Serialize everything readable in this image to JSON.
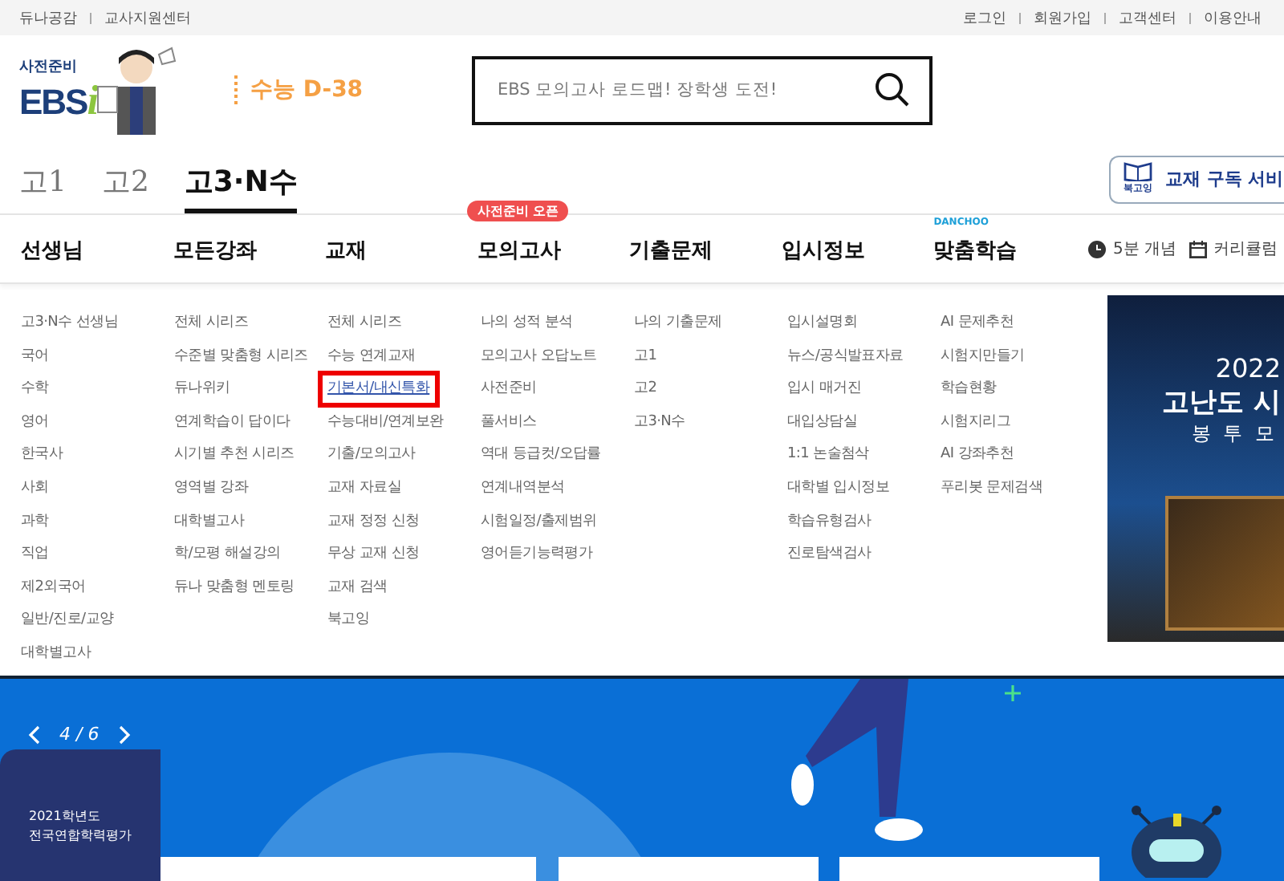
{
  "top_bar": {
    "left_links": [
      "듀나공감",
      "교사지원센터"
    ],
    "right_links": [
      "로그인",
      "회원가입",
      "고객센터",
      "이용안내"
    ]
  },
  "logo": {
    "tagline": "사전준비",
    "brand": "EBS",
    "mark": "i"
  },
  "d_day": "수능 D-38",
  "search": {
    "placeholder": "EBS 모의고사 로드맵! 장학생 도전!"
  },
  "grade_tabs": [
    {
      "label": "고1",
      "selected": false
    },
    {
      "label": "고2",
      "selected": false
    },
    {
      "label": "고3·N수",
      "selected": true
    }
  ],
  "book_service": {
    "icon_label": "북고잉",
    "label": "교재 구독 서비"
  },
  "nav": [
    {
      "label": "선생님"
    },
    {
      "label": "모든강좌"
    },
    {
      "label": "교재"
    },
    {
      "label": "모의고사",
      "badge": "사전준비 오픈"
    },
    {
      "label": "기출문제"
    },
    {
      "label": "입시정보"
    },
    {
      "label": "맞춤학습",
      "tag": "DANCHOO"
    }
  ],
  "quick_links": [
    "5분 개념",
    "커리큘럼"
  ],
  "menu_columns": [
    {
      "items": [
        {
          "label": "고3·N수 선생님",
          "highlighted": false
        },
        {
          "label": "국어",
          "highlighted": false
        },
        {
          "label": "수학",
          "highlighted": false
        },
        {
          "label": "영어",
          "highlighted": false
        },
        {
          "label": "한국사",
          "highlighted": false
        },
        {
          "label": "사회",
          "highlighted": false
        },
        {
          "label": "과학",
          "highlighted": false
        },
        {
          "label": "직업",
          "highlighted": false
        },
        {
          "label": "제2외국어",
          "highlighted": false
        },
        {
          "label": "일반/진로/교양",
          "highlighted": false
        },
        {
          "label": "대학별고사",
          "highlighted": false
        }
      ]
    },
    {
      "items": [
        {
          "label": "전체 시리즈",
          "highlighted": false
        },
        {
          "label": "수준별 맞춤형 시리즈",
          "highlighted": false
        },
        {
          "label": "듀나위키",
          "highlighted": false
        },
        {
          "label": "연계학습이 답이다",
          "highlighted": false
        },
        {
          "label": "시기별 추천 시리즈",
          "highlighted": false
        },
        {
          "label": "영역별 강좌",
          "highlighted": false
        },
        {
          "label": "대학별고사",
          "highlighted": false
        },
        {
          "label": "학/모평 해설강의",
          "highlighted": false
        },
        {
          "label": "듀나 맞춤형 멘토링",
          "highlighted": false
        }
      ]
    },
    {
      "items": [
        {
          "label": "전체 시리즈",
          "highlighted": false
        },
        {
          "label": "수능 연계교재",
          "highlighted": false
        },
        {
          "label": "기본서/내신특화",
          "highlighted": true
        },
        {
          "label": "수능대비/연계보완",
          "highlighted": false
        },
        {
          "label": "기출/모의고사",
          "highlighted": false
        },
        {
          "label": "교재 자료실",
          "highlighted": false
        },
        {
          "label": "교재 정정 신청",
          "highlighted": false
        },
        {
          "label": "무상 교재 신청",
          "highlighted": false
        },
        {
          "label": "교재 검색",
          "highlighted": false
        },
        {
          "label": "북고잉",
          "highlighted": false
        }
      ]
    },
    {
      "items": [
        {
          "label": "나의 성적 분석",
          "highlighted": false
        },
        {
          "label": "모의고사 오답노트",
          "highlighted": false
        },
        {
          "label": "사전준비",
          "highlighted": false
        },
        {
          "label": "풀서비스",
          "highlighted": false
        },
        {
          "label": "역대 등급컷/오답률",
          "highlighted": false
        },
        {
          "label": "연계내역분석",
          "highlighted": false
        },
        {
          "label": "시험일정/출제범위",
          "highlighted": false
        },
        {
          "label": "영어듣기능력평가",
          "highlighted": false
        }
      ]
    },
    {
      "items": [
        {
          "label": "나의 기출문제",
          "highlighted": false
        },
        {
          "label": "고1",
          "highlighted": false
        },
        {
          "label": "고2",
          "highlighted": false
        },
        {
          "label": "고3·N수",
          "highlighted": false
        }
      ]
    },
    {
      "items": [
        {
          "label": "입시설명회",
          "highlighted": false
        },
        {
          "label": "뉴스/공식발표자료",
          "highlighted": false
        },
        {
          "label": "입시 매거진",
          "highlighted": false
        },
        {
          "label": "대입상담실",
          "highlighted": false
        },
        {
          "label": "1:1 논술첨삭",
          "highlighted": false
        },
        {
          "label": "대학별 입시정보",
          "highlighted": false
        },
        {
          "label": "학습유형검사",
          "highlighted": false
        },
        {
          "label": "진로탐색검사",
          "highlighted": false
        }
      ]
    },
    {
      "items": [
        {
          "label": "AI 문제추천",
          "highlighted": false
        },
        {
          "label": "시험지만들기",
          "highlighted": false
        },
        {
          "label": "학습현황",
          "highlighted": false
        },
        {
          "label": "시험지리그",
          "highlighted": false
        },
        {
          "label": "AI 강좌추천",
          "highlighted": false
        },
        {
          "label": "푸리봇 문제검색",
          "highlighted": false
        }
      ]
    }
  ],
  "promo_banner": {
    "year": "2022",
    "title": "고난도 시",
    "subtitle": "봉 투 모"
  },
  "hero": {
    "counter": "4 / 6",
    "card_lines": [
      "2021학년도",
      "전국연합학력평가"
    ]
  }
}
